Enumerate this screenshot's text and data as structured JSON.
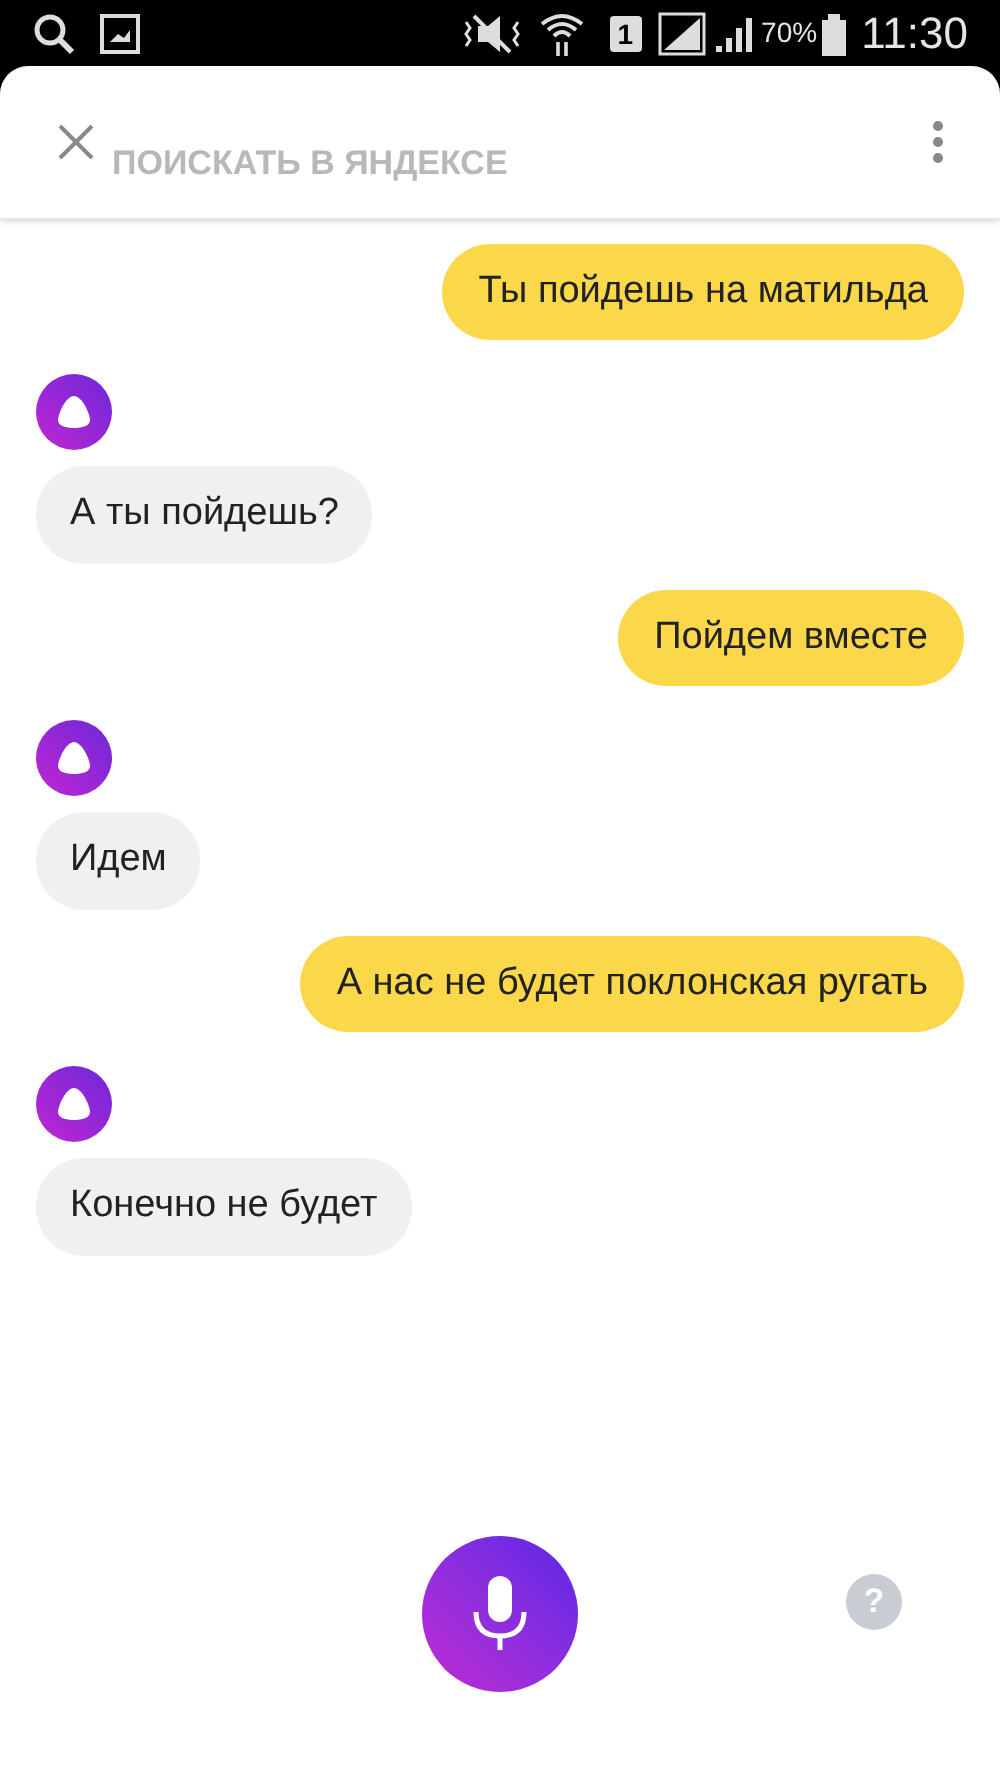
{
  "status_bar": {
    "sim": "1",
    "battery": "70%",
    "time": "11:30"
  },
  "header": {
    "background_text": "ПОИСКАТЬ В ЯНДЕКСЕ"
  },
  "messages": [
    {
      "kind": "user",
      "text": "Ты пойдешь на матильда"
    },
    {
      "kind": "assistant",
      "text": "А ты пойдешь?"
    },
    {
      "kind": "user",
      "text": "Пойдем вместе"
    },
    {
      "kind": "assistant",
      "text": "Идем"
    },
    {
      "kind": "user",
      "text": "А нас не будет поклонская ругать"
    },
    {
      "kind": "assistant",
      "text": "Конечно не будет"
    }
  ],
  "help": {
    "label": "?"
  }
}
